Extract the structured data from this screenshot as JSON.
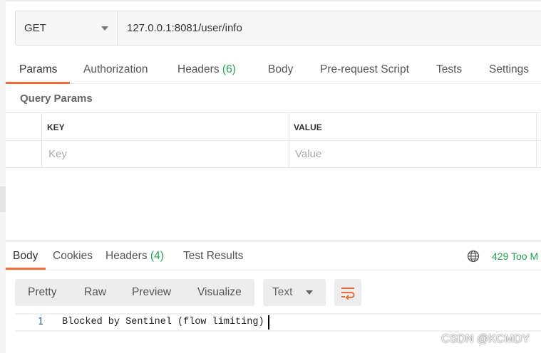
{
  "request": {
    "method": "GET",
    "url": "127.0.0.1:8081/user/info"
  },
  "request_tabs": [
    {
      "label": "Params"
    },
    {
      "label": "Authorization"
    },
    {
      "label": "Headers",
      "count": "(6)"
    },
    {
      "label": "Body"
    },
    {
      "label": "Pre-request Script"
    },
    {
      "label": "Tests"
    },
    {
      "label": "Settings"
    }
  ],
  "query_params": {
    "title": "Query Params",
    "headers": {
      "key": "KEY",
      "value": "VALUE"
    },
    "placeholders": {
      "key": "Key",
      "value": "Value"
    }
  },
  "response_tabs": [
    {
      "label": "Body"
    },
    {
      "label": "Cookies"
    },
    {
      "label": "Headers",
      "count": "(4)"
    },
    {
      "label": "Test Results"
    }
  ],
  "response_status": "429 Too M",
  "view_modes": [
    "Pretty",
    "Raw",
    "Preview",
    "Visualize"
  ],
  "format": "Text",
  "response_body": {
    "line_number": "1",
    "text": "Blocked by Sentinel (flow limiting)"
  },
  "watermark": "CSDN @KCMDY",
  "colors": {
    "accent": "#f26b3a",
    "status_green": "#23a455",
    "line_number_blue": "#1a5aa8"
  },
  "icons": {
    "method_dropdown": "chevron-down-icon",
    "globe": "globe-icon",
    "format_dropdown": "chevron-down-icon",
    "wrap": "wrap-lines-icon"
  }
}
